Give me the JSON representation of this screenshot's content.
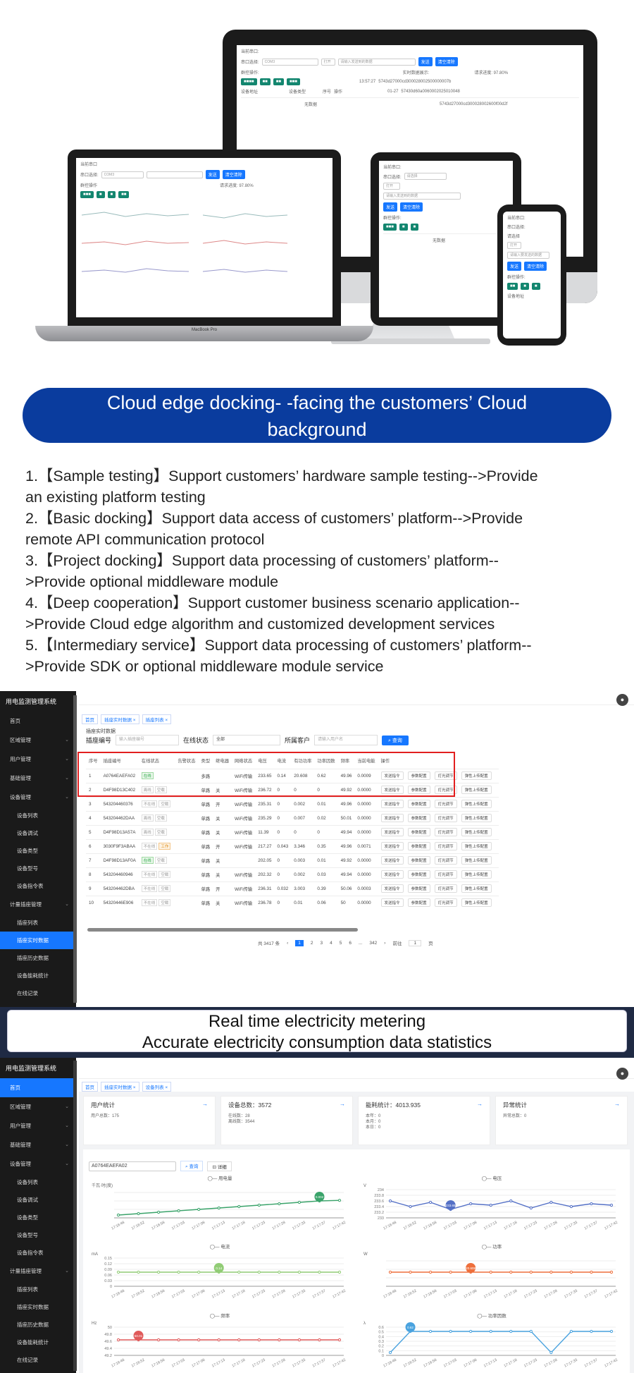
{
  "hero": {
    "imac": {
      "port_label": "当前串口:",
      "select_label": "串口选择:",
      "select_value": "COM3",
      "open_btn": "打开",
      "hint": "请输入发送到的数据",
      "send_btn": "发送",
      "clear_btn": "清空清除",
      "progress": "请求进度: 97.80%",
      "batch_label": "群控操作:",
      "data_label": "实时数据展示:",
      "col_device": "设备地址",
      "col_type": "设备类型",
      "col_seq": "序号",
      "col_op": "操作",
      "empty": "无数据",
      "log_time": "13:57:27",
      "log_date": "01-27",
      "log_hex_1": "5743d27000cd300028002500000007b",
      "log_hex_2": "57430d60a0060002025010048",
      "log_hex_3": "5743d27000cd300028002600f00d2f"
    },
    "laptop": {
      "port_label": "当前串口",
      "select_label": "串口选择:",
      "select_value": "COM3",
      "send_btn": "发送",
      "clear_btn": "清空清除",
      "progress": "请求进度: 97.80%",
      "batch_label": "群控操作",
      "brand": "MacBook Pro"
    },
    "tablet": {
      "port_label": "当前串口:",
      "select_label": "串口选择:",
      "select_value": "请选择",
      "open_btn": "打开",
      "hint": "请输入发送到的数据",
      "send_btn": "发送",
      "clear_btn": "清空清除",
      "batch_label": "群控操作:",
      "empty": "无数据"
    },
    "phone": {
      "port_label": "当前串口:",
      "select_label": "串口选择:",
      "select_value": "请选择",
      "open_btn": "打开",
      "hint": "请输入要发送的数据",
      "send_btn": "发送",
      "clear_btn": "清空清除",
      "batch_label": "群控操作:",
      "device_label": "设备地址"
    }
  },
  "banner": {
    "line1": "Cloud edge docking- -facing the customers’ Cloud",
    "line2": "background"
  },
  "features": [
    {
      "l1": "1.【Sample testing】Support customers’ hardware sample testing-->Provide",
      "l2": "an existing platform testing"
    },
    {
      "l1": "2.【Basic docking】Support data access of customers’ platform-->Provide",
      "l2": "remote API communication protocol"
    },
    {
      "l1": "3.【Project docking】Support data processing of customers’ platform--",
      "l2": ">Provide optional middleware module"
    },
    {
      "l1": "4.【Deep cooperation】Support customer business scenario application--",
      "l2": ">Provide Cloud edge algorithm and customized development services"
    },
    {
      "l1": "5.【Intermediary service】Support data processing of customers’ platform--",
      "l2": ">Provide SDK or optional middleware module service"
    }
  ],
  "admin1": {
    "brand": "用电监测管理系统",
    "nav": [
      {
        "label": "首页",
        "sub": false
      },
      {
        "label": "区域管理",
        "sub": false
      },
      {
        "label": "用户管理",
        "sub": false
      },
      {
        "label": "基础管理",
        "sub": false
      },
      {
        "label": "设备管理",
        "sub": false
      },
      {
        "label": "设备列表",
        "sub": true
      },
      {
        "label": "设备调试",
        "sub": true
      },
      {
        "label": "设备类型",
        "sub": true
      },
      {
        "label": "设备型号",
        "sub": true
      },
      {
        "label": "设备指令表",
        "sub": true
      },
      {
        "label": "计量插座管理",
        "sub": false
      },
      {
        "label": "插座列表",
        "sub": true
      },
      {
        "label": "插座实时数据",
        "sub": true,
        "active": true
      },
      {
        "label": "插座历史数据",
        "sub": true
      },
      {
        "label": "设备能耗统计",
        "sub": true
      },
      {
        "label": "在线记录",
        "sub": true
      }
    ],
    "crumbs": [
      "首页",
      "插座实时数据 ×",
      "插座列表 ×"
    ],
    "page_title": "插座实时数据",
    "filter_code_label": "插座编号",
    "filter_code_ph": "输入插座编号",
    "filter_status_label": "在线状态",
    "filter_status_value": "全部",
    "filter_user_label": "所属客户",
    "filter_user_ph": "请输入用户名",
    "query_btn": "查询",
    "columns": [
      "序号",
      "插座编号",
      "在线状态",
      "告警状态",
      "类型",
      "继电器",
      "网络状态",
      "电压",
      "电流",
      "有功功率",
      "功率因数",
      "频率",
      "当前电能",
      "操作"
    ],
    "rows": [
      {
        "n": "1",
        "code": "A0764EAEFA02",
        "st": "在线",
        "st_c": "green",
        "alarm": "",
        "type": "多路",
        "relay": "",
        "net": "WiFi传输",
        "v": "233.65",
        "a": "0.14",
        "p": "20.608",
        "pf": "0.62",
        "hz": "49.96",
        "e": "0.0009"
      },
      {
        "n": "2",
        "code": "D4F98D13C402",
        "st": "离线",
        "st_c": "",
        "alarm": "空载",
        "type": "单路",
        "relay": "关",
        "net": "WiFi传输",
        "v": "236.72",
        "a": "0",
        "p": "0",
        "pf": "0",
        "hz": "49.92",
        "e": "0.0000"
      },
      {
        "n": "3",
        "code": "543204460376",
        "st": "不在线",
        "st_c": "",
        "alarm": "空载",
        "type": "单路",
        "relay": "开",
        "net": "WiFi传输",
        "v": "235.31",
        "a": "0",
        "p": "0.002",
        "pf": "0.01",
        "hz": "49.96",
        "e": "0.0000"
      },
      {
        "n": "4",
        "code": "543204462DAA",
        "st": "离线",
        "st_c": "",
        "alarm": "空载",
        "type": "单路",
        "relay": "关",
        "net": "WiFi传输",
        "v": "235.29",
        "a": "0",
        "p": "0.007",
        "pf": "0.02",
        "hz": "50.01",
        "e": "0.0000"
      },
      {
        "n": "5",
        "code": "D4F98D13A57A",
        "st": "离线",
        "st_c": "",
        "alarm": "空载",
        "type": "单路",
        "relay": "关",
        "net": "WiFi传输",
        "v": "11.39",
        "a": "0",
        "p": "0",
        "pf": "0",
        "hz": "49.94",
        "e": "0.0000"
      },
      {
        "n": "6",
        "code": "3030F9F3ABAA",
        "st": "不在线",
        "st_c": "",
        "alarm": "工作",
        "alarm_c": "orange",
        "type": "单路",
        "relay": "开",
        "net": "WiFi传输",
        "v": "217.27",
        "a": "0.043",
        "p": "3.346",
        "pf": "0.35",
        "hz": "49.96",
        "e": "0.0071"
      },
      {
        "n": "7",
        "code": "D4F98D13AF0A",
        "st": "在线",
        "st_c": "green",
        "alarm": "空载",
        "type": "单路",
        "relay": "关",
        "net": "",
        "v": "202.05",
        "a": "0",
        "p": "0.003",
        "pf": "0.01",
        "hz": "49.92",
        "e": "0.0000"
      },
      {
        "n": "8",
        "code": "543204460946",
        "st": "不在线",
        "st_c": "",
        "alarm": "空载",
        "type": "单路",
        "relay": "关",
        "net": "WiFi传输",
        "v": "202.32",
        "a": "0",
        "p": "0.002",
        "pf": "0.03",
        "hz": "49.94",
        "e": "0.0000"
      },
      {
        "n": "9",
        "code": "543204462DBA",
        "st": "不在线",
        "st_c": "",
        "alarm": "空载",
        "type": "单路",
        "relay": "开",
        "net": "WiFi传输",
        "v": "236.31",
        "a": "0.032",
        "p": "3.003",
        "pf": "0.39",
        "hz": "50.06",
        "e": "0.0003"
      },
      {
        "n": "10",
        "code": "54320446E906",
        "st": "不在线",
        "st_c": "",
        "alarm": "空载",
        "type": "单路",
        "relay": "关",
        "net": "WiFi传输",
        "v": "236.78",
        "a": "0",
        "p": "0.01",
        "pf": "0.06",
        "hz": "50",
        "e": "0.0000"
      }
    ],
    "ops": [
      "发送指令",
      "参数配置",
      "灯光调节",
      "弹性上传配置"
    ],
    "pager": {
      "total": "共 3417 条",
      "pages": [
        "1",
        "2",
        "3",
        "4",
        "5",
        "6",
        "...",
        "342"
      ],
      "current": "1",
      "goto": "前往",
      "goto_val": "1",
      "unit": "页"
    }
  },
  "caption": {
    "line1": "Real time electricity metering",
    "line2": "Accurate electricity consumption data statistics"
  },
  "admin2": {
    "brand": "用电监测管理系统",
    "nav": [
      {
        "label": "首页",
        "sub": false,
        "active": true
      },
      {
        "label": "区域管理",
        "sub": false
      },
      {
        "label": "用户管理",
        "sub": false
      },
      {
        "label": "基础管理",
        "sub": false
      },
      {
        "label": "设备管理",
        "sub": false
      },
      {
        "label": "设备列表",
        "sub": true
      },
      {
        "label": "设备调试",
        "sub": true
      },
      {
        "label": "设备类型",
        "sub": true
      },
      {
        "label": "设备型号",
        "sub": true
      },
      {
        "label": "设备指令表",
        "sub": true
      },
      {
        "label": "计量插座管理",
        "sub": false
      },
      {
        "label": "插座列表",
        "sub": true
      },
      {
        "label": "插座实时数据",
        "sub": true
      },
      {
        "label": "插座历史数据",
        "sub": true
      },
      {
        "label": "设备能耗统计",
        "sub": true
      },
      {
        "label": "在线记录",
        "sub": true
      }
    ],
    "crumbs": [
      "首页",
      "插座实时数据 ×",
      "设备列表 ×"
    ],
    "cards": [
      {
        "title": "用户统计",
        "lines": [
          "用户总数：175"
        ]
      },
      {
        "title": "设备总数：3572",
        "lines": [
          "在线数：28",
          "离线数：3544"
        ]
      },
      {
        "title": "能耗统计：4013.935",
        "lines": [
          "本年：0",
          "本月：0",
          "本日：0"
        ]
      },
      {
        "title": "异常统计",
        "lines": [
          "异常总数：0"
        ]
      }
    ],
    "search_value": "A0764EAEFA02",
    "query_btn": "查询",
    "reset_btn": "详细",
    "charts": [
      {
        "legend": "用电量",
        "unit": "千瓦·时(度)",
        "color": "#3aa36a",
        "peak": "0.002",
        "ticks": []
      },
      {
        "legend": "电压",
        "unit": "V",
        "color": "#5470c6",
        "peak": "233.65",
        "ticks": [
          "234",
          "233.8",
          "233.6",
          "233.4",
          "233.2",
          "233"
        ]
      },
      {
        "legend": "电流",
        "unit": "mA",
        "color": "#91cc75",
        "peak": "0.14",
        "ticks": [
          "0.15",
          "0.12",
          "0.09",
          "0.06",
          "0.03",
          "0"
        ]
      },
      {
        "legend": "功率",
        "unit": "W",
        "color": "#ee6f3c",
        "peak": "20.608",
        "ticks": []
      },
      {
        "legend": "频率",
        "unit": "Hz",
        "color": "#e05a5a",
        "peak": "50.01",
        "ticks": [
          "50",
          "49.8",
          "49.6",
          "49.4",
          "49.2"
        ]
      },
      {
        "legend": "功率因数",
        "unit": "λ",
        "color": "#4aa3df",
        "peak": "0.62",
        "ticks": [
          "0.6",
          "0.5",
          "0.4",
          "0.3",
          "0.2",
          "0.1",
          "0"
        ]
      }
    ],
    "x_times": [
      "17:16:48",
      "17:16:52",
      "17:16:58",
      "17:17:03",
      "17:17:08",
      "17:17:13",
      "17:17:18",
      "17:17:23",
      "17:17:28",
      "17:17:33",
      "17:17:37",
      "17:17:42"
    ]
  }
}
